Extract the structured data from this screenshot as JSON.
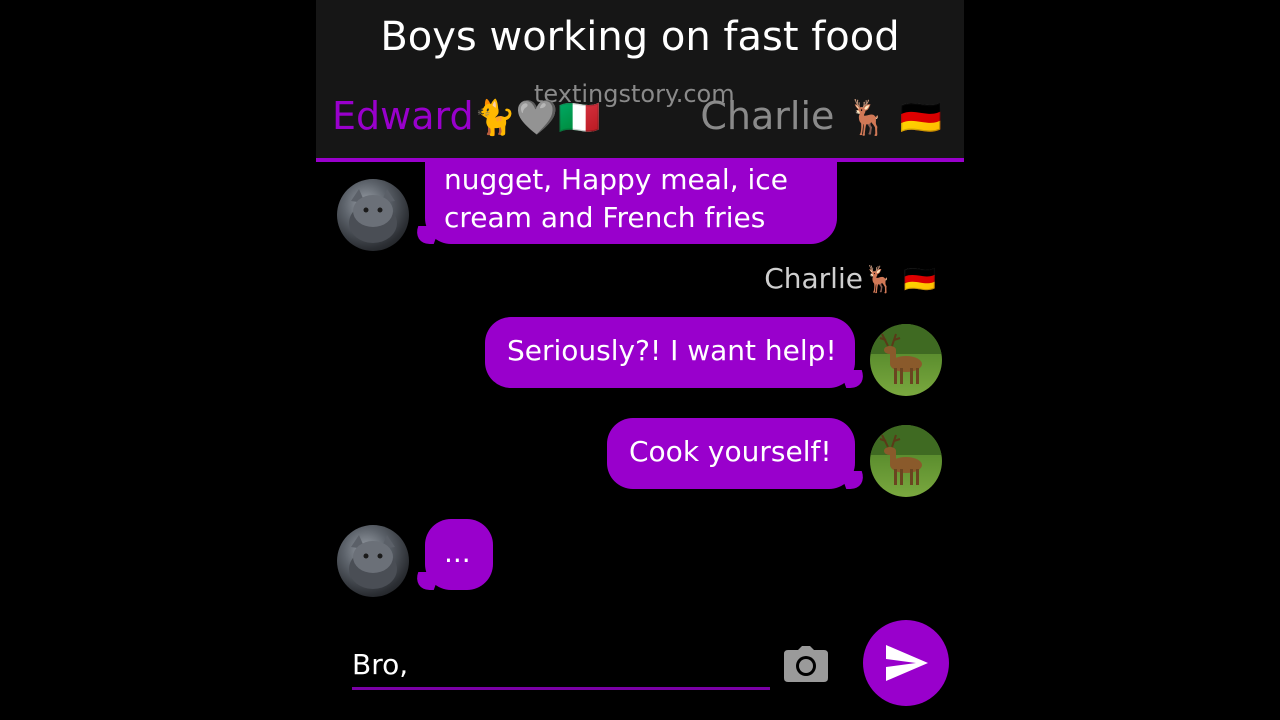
{
  "header": {
    "title": "Boys working on fast food",
    "watermark": "textingstory.com",
    "left_contact": "Edward",
    "left_contact_emojis": "🐈🩶🇮🇹",
    "right_contact": "Charlie",
    "right_contact_emojis": "🦌 🇩🇪"
  },
  "messages": [
    {
      "sender": "Edward",
      "side": "left",
      "lines": [
        "nugget, Happy meal, ice",
        "cream and French fries"
      ]
    },
    {
      "sender": "Charlie",
      "side": "right",
      "label": "Charlie",
      "label_emojis": "🦌 🇩🇪",
      "text": "Seriously?! I want help!"
    },
    {
      "sender": "Charlie",
      "side": "right",
      "text": "Cook yourself!"
    },
    {
      "sender": "Edward",
      "side": "left",
      "text": "..."
    }
  ],
  "composer": {
    "value": "Bro,",
    "camera_icon": "camera-icon",
    "send_icon": "send-icon"
  },
  "colors": {
    "accent": "#9900cc",
    "header_bg": "#161616",
    "background": "#000000",
    "muted_text": "#8a8a8a"
  }
}
